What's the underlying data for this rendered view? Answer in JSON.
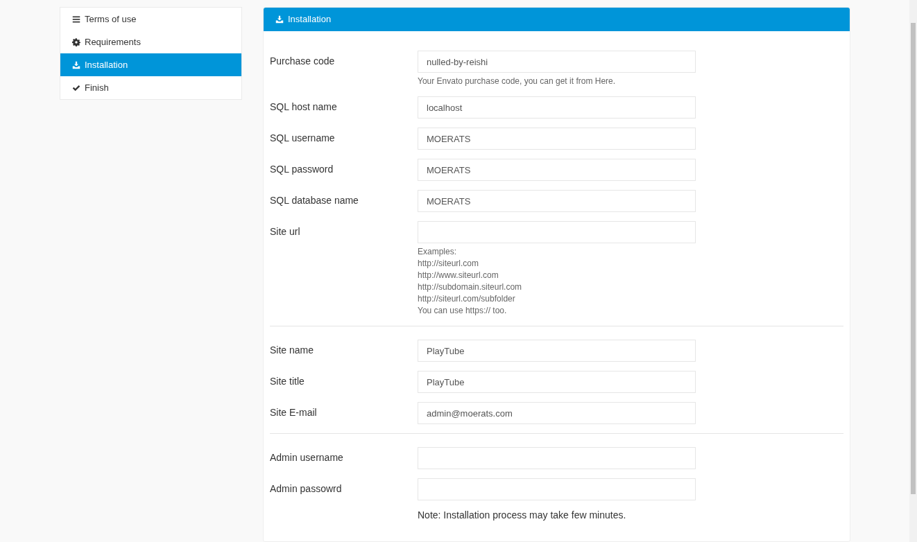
{
  "sidebar": {
    "items": [
      {
        "label": "Terms of use",
        "selected": false
      },
      {
        "label": "Requirements",
        "selected": false
      },
      {
        "label": "Installation",
        "selected": true
      },
      {
        "label": "Finish",
        "selected": false
      }
    ]
  },
  "panel": {
    "title": "Installation",
    "sections": [
      {
        "fields": [
          {
            "label": "Purchase code",
            "value": "nulled-by-reishi",
            "help": [
              "Your Envato purchase code, you can get it from Here."
            ]
          },
          {
            "label": "SQL host name",
            "value": "localhost"
          },
          {
            "label": "SQL username",
            "value": "MOERATS"
          },
          {
            "label": "SQL password",
            "value": "MOERATS"
          },
          {
            "label": "SQL database name",
            "value": "MOERATS"
          },
          {
            "label": "Site url",
            "help": [
              "Examples:",
              "http://siteurl.com",
              "http://www.siteurl.com",
              "http://subdomain.siteurl.com",
              "http://siteurl.com/subfolder",
              "You can use https:// too."
            ]
          }
        ]
      },
      {
        "fields": [
          {
            "label": "Site name",
            "value": "PlayTube"
          },
          {
            "label": "Site title",
            "value": "PlayTube"
          },
          {
            "label": "Site E-mail",
            "value": "admin@moerats.com"
          }
        ]
      },
      {
        "fields": [
          {
            "label": "Admin username"
          },
          {
            "label": "Admin passowrd"
          }
        ]
      }
    ],
    "note": "Note: Installation process may take few minutes."
  }
}
